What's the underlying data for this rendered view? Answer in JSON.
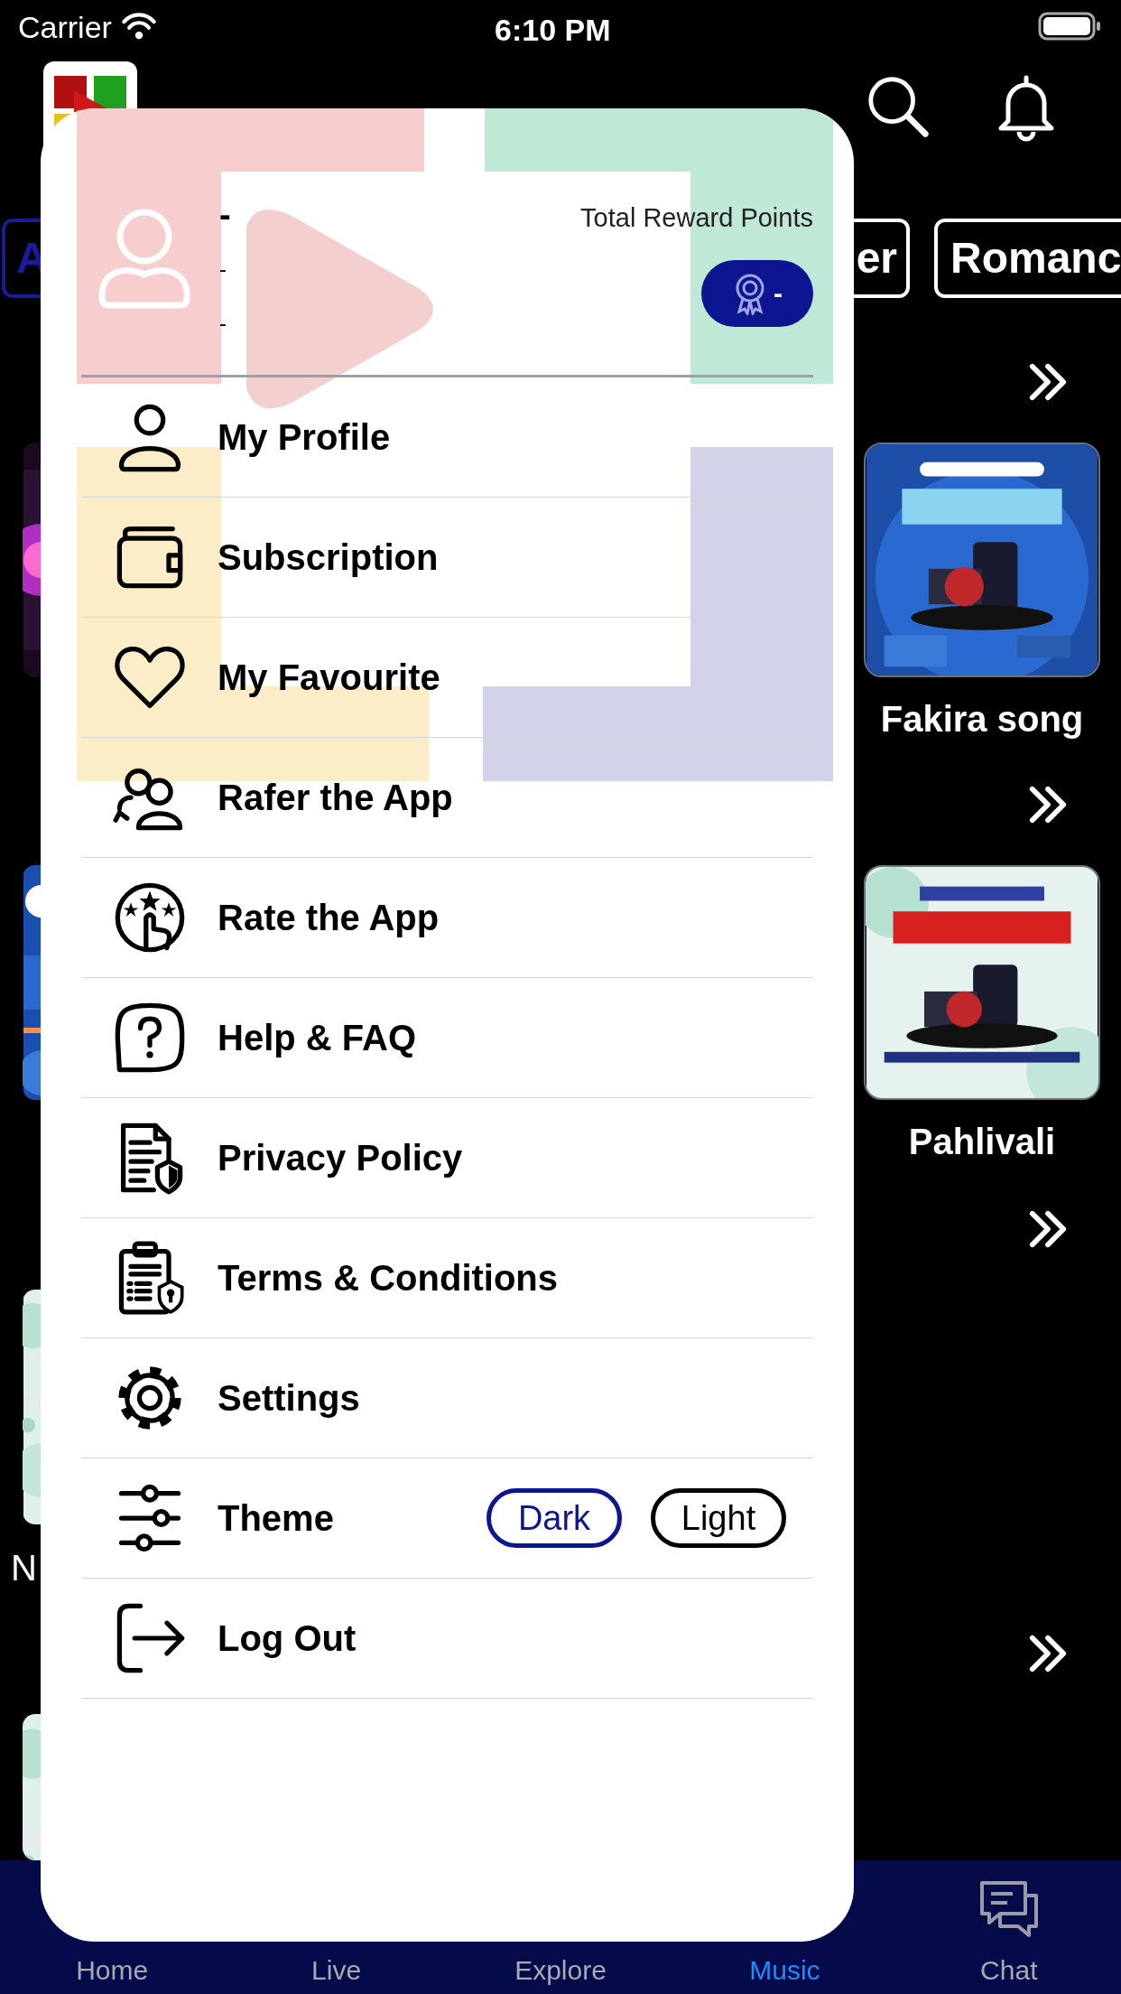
{
  "status_bar": {
    "carrier": "Carrier",
    "time": "6:10 PM"
  },
  "categories": [
    {
      "label": "A",
      "selected": true
    },
    {
      "label": "er",
      "selected": false
    },
    {
      "label": "Romanc",
      "selected": false
    }
  ],
  "left_text": "N",
  "posters": [
    {
      "title": "Fakira song",
      "kind": "picture"
    },
    {
      "title": "Pahlivali",
      "kind": "picture"
    }
  ],
  "drawer": {
    "user": {
      "name": "-",
      "line_2": "-",
      "line_3": "-"
    },
    "reward_label": "Total Reward Points",
    "reward_points": "-",
    "menu": [
      {
        "label": "My Profile",
        "kind": "link"
      },
      {
        "label": "Subscription",
        "kind": "link"
      },
      {
        "label": "My Favourite",
        "kind": "link"
      },
      {
        "label": "Rafer the App",
        "kind": "link"
      },
      {
        "label": "Rate the App",
        "kind": "link"
      },
      {
        "label": "Help & FAQ",
        "kind": "link"
      },
      {
        "label": "Privacy Policy",
        "kind": "link"
      },
      {
        "label": "Terms & Conditions",
        "kind": "link"
      },
      {
        "label": "Settings",
        "kind": "link"
      },
      {
        "label": "Theme",
        "kind": "theme",
        "options": [
          {
            "label": "Dark",
            "selected": true
          },
          {
            "label": "Light",
            "selected": false
          }
        ]
      },
      {
        "label": "Log Out",
        "kind": "link"
      }
    ]
  },
  "tab_bar": [
    {
      "label": "Home",
      "selected": false
    },
    {
      "label": "Live",
      "selected": false
    },
    {
      "label": "Explore",
      "selected": false
    },
    {
      "label": "Music",
      "selected": true
    },
    {
      "label": "Chat",
      "selected": false
    }
  ]
}
